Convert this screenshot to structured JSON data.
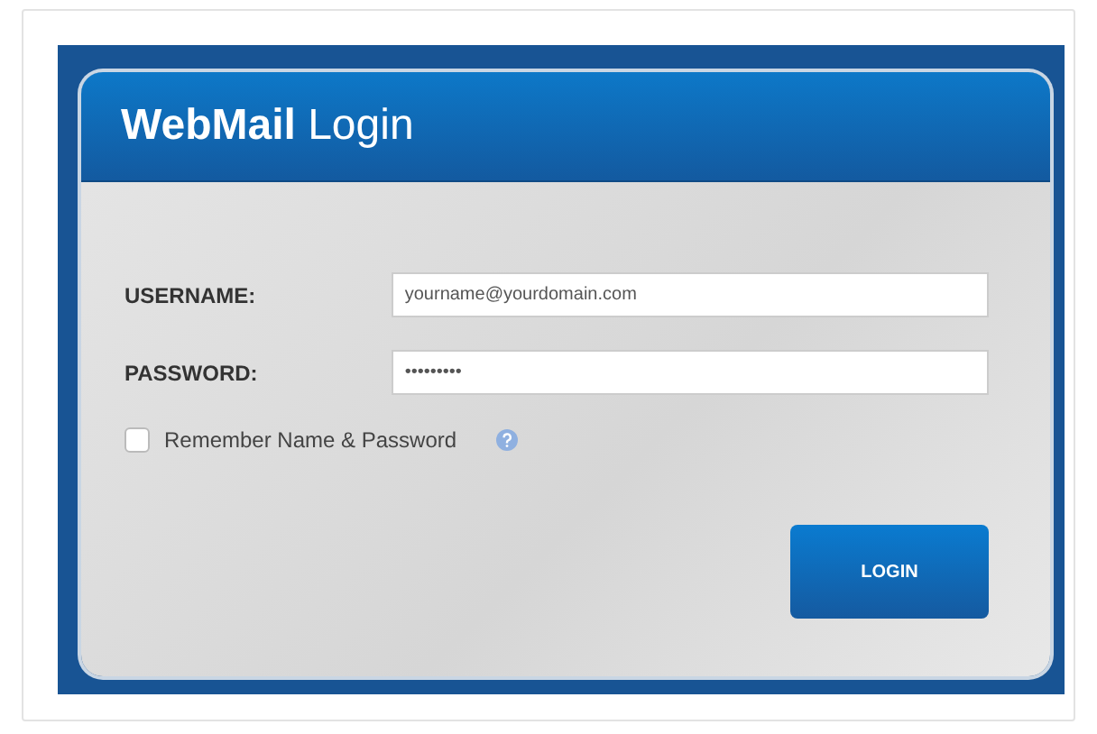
{
  "title": "**WebMail** Login",
  "fields": [
    {
      "label": "USERNAME:",
      "value": "yourname@yourdomain.com"
    },
    {
      "label": "PASSWORD:",
      "value": "•••••••••"
    }
  ],
  "remember": {
    "label": "Remember Name & Password",
    "checked": false
  },
  "button": "LOGIN"
}
